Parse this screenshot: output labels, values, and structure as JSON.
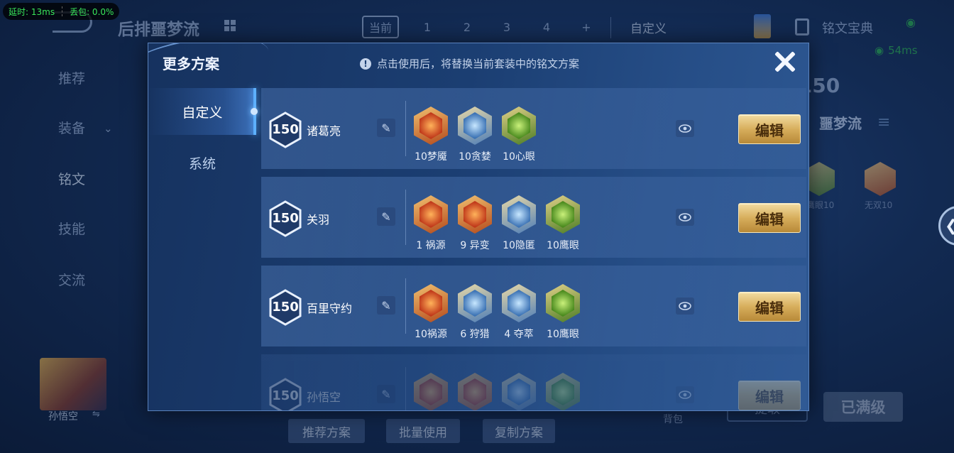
{
  "network": {
    "latency": "延时: 13ms",
    "packet_loss": "丢包: 0.0%"
  },
  "background": {
    "title": "后排噩梦流",
    "tabs": [
      "当前",
      "1",
      "2",
      "3",
      "4",
      "+"
    ],
    "custom_label": "自定义",
    "rune_library": "铭文宝典",
    "ping": "54ms",
    "level_badge": "150",
    "side_set_name": "噩梦流",
    "nav": [
      "推荐",
      "装备",
      "铭文",
      "技能",
      "交流"
    ],
    "side_runes": [
      {
        "label": "鹰眼10",
        "color": "green"
      },
      {
        "label": "无双10",
        "color": "red"
      }
    ],
    "hero_name": "孙悟空",
    "bottom_buttons": [
      "推荐方案",
      "批量使用",
      "复制方案"
    ],
    "bag_label": "背包",
    "max_level_label": "已满级",
    "extract_label": "提取"
  },
  "dialog": {
    "title": "更多方案",
    "hint": "点击使用后，将替换当前套装中的铭文方案",
    "tabs": [
      "自定义",
      "系统"
    ],
    "edit_label": "编辑",
    "rows": [
      {
        "level": "150",
        "hero": "诸葛亮",
        "runes": [
          {
            "label": "10梦魇",
            "color": "red",
            "icon": "dream-rune-icon"
          },
          {
            "label": "10贪婪",
            "color": "blue",
            "icon": "greed-rune-icon"
          },
          {
            "label": "10心眼",
            "color": "green",
            "icon": "mind-eye-rune-icon"
          }
        ]
      },
      {
        "level": "150",
        "hero": "关羽",
        "runes": [
          {
            "label": "1 祸源",
            "color": "red",
            "icon": "calamity-rune-icon"
          },
          {
            "label": "9 异变",
            "color": "red",
            "icon": "mutation-rune-icon"
          },
          {
            "label": "10隐匿",
            "color": "blue",
            "icon": "hidden-rune-icon"
          },
          {
            "label": "10鹰眼",
            "color": "green",
            "icon": "hawk-eye-rune-icon"
          }
        ]
      },
      {
        "level": "150",
        "hero": "百里守约",
        "runes": [
          {
            "label": "10祸源",
            "color": "red",
            "icon": "calamity-rune-icon"
          },
          {
            "label": "6 狩猎",
            "color": "blue",
            "icon": "hunt-rune-icon"
          },
          {
            "label": "4 夺萃",
            "color": "blue",
            "icon": "plunder-rune-icon"
          },
          {
            "label": "10鹰眼",
            "color": "green",
            "icon": "hawk-eye-rune-icon"
          }
        ]
      },
      {
        "level": "150",
        "hero": "孙悟空",
        "runes": [
          {
            "label": "",
            "color": "red",
            "icon": "calamity-rune-icon"
          },
          {
            "label": "",
            "color": "red",
            "icon": "calamity-rune-icon"
          },
          {
            "label": "",
            "color": "blue",
            "icon": "hunt-rune-icon"
          },
          {
            "label": "",
            "color": "green",
            "icon": "hawk-eye-rune-icon"
          }
        ]
      }
    ]
  }
}
